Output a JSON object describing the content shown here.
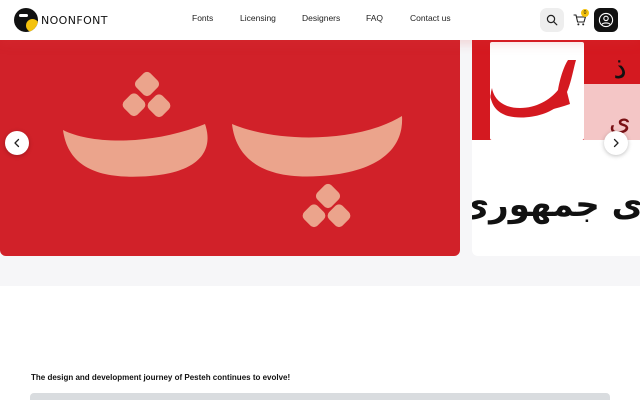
{
  "brand": {
    "name": "NOONFONT"
  },
  "nav": {
    "fonts": "Fonts",
    "licensing": "Licensing",
    "designers": "Designers",
    "faq": "FAQ",
    "contact": "Contact us"
  },
  "header_actions": {
    "search_icon": "search-icon",
    "cart_icon": "cart-icon",
    "cart_count": "0",
    "account_icon": "user-icon"
  },
  "carousel": {
    "main_slide": {
      "glyphs": "پ ث",
      "background": "#d12129",
      "glyph_color": "#eba48c"
    },
    "next_slide": {
      "glyph_top": "س",
      "glyph_right_top": "ذ",
      "glyph_right_bottom": "ي",
      "text": "رای جمهوری",
      "accent": "#d41920"
    },
    "prev_icon": "chevron-left-icon",
    "next_icon": "chevron-right-icon"
  },
  "article": {
    "intro": "The design and development journey of Pesteh continues to evolve!"
  },
  "colors": {
    "brand_yellow": "#f4c20d",
    "brand_black": "#111111",
    "slide_red": "#d12129"
  }
}
